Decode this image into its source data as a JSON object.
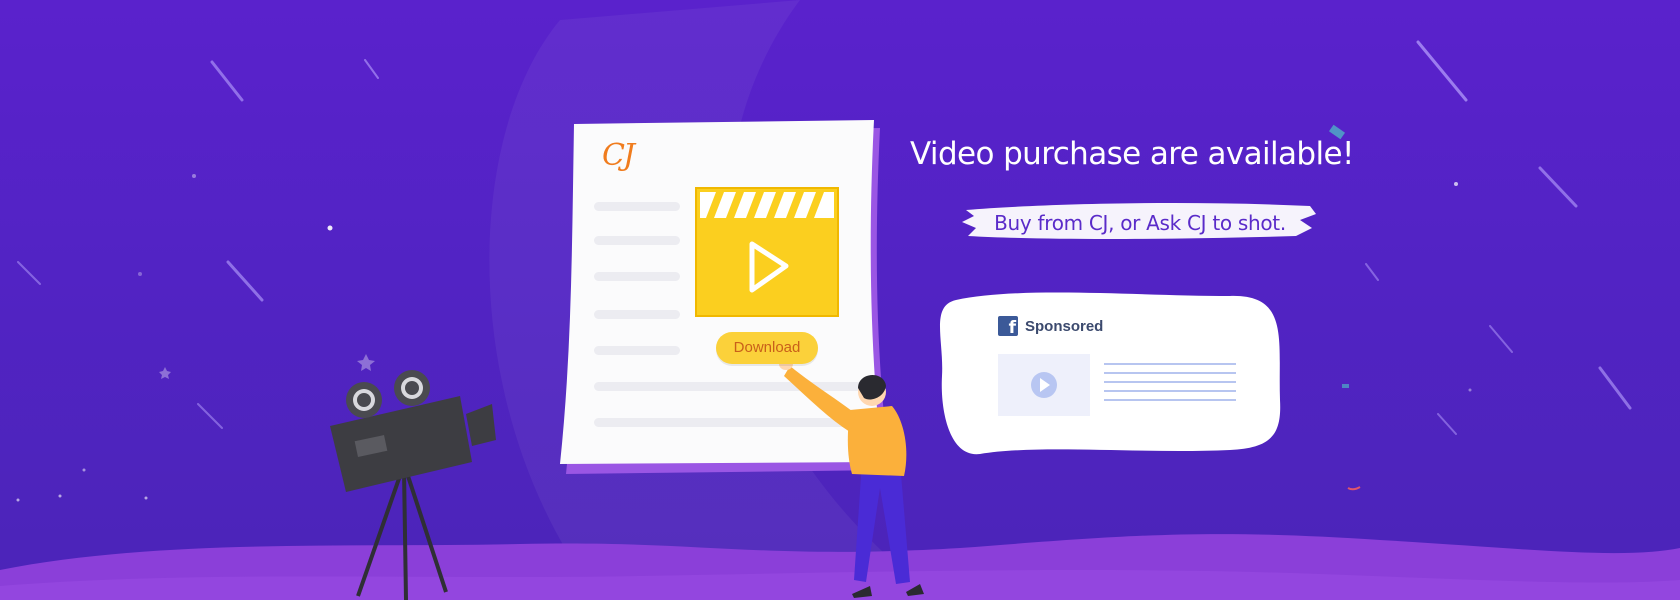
{
  "document": {
    "logo_text": "CJ",
    "download_label": "Download"
  },
  "promo": {
    "headline": "Video purchase are available!",
    "subheadline": "Buy from CJ, or Ask CJ to shot."
  },
  "ad_card": {
    "platform_icon": "facebook-icon",
    "sponsored_label": "Sponsored",
    "thumbnail_icon": "play-icon"
  },
  "colors": {
    "background": "#5223c4",
    "ground": "#8b3fd9",
    "accent_yellow": "#fbd13a",
    "logo_orange": "#f07c1e",
    "facebook_blue": "#3b5998"
  }
}
